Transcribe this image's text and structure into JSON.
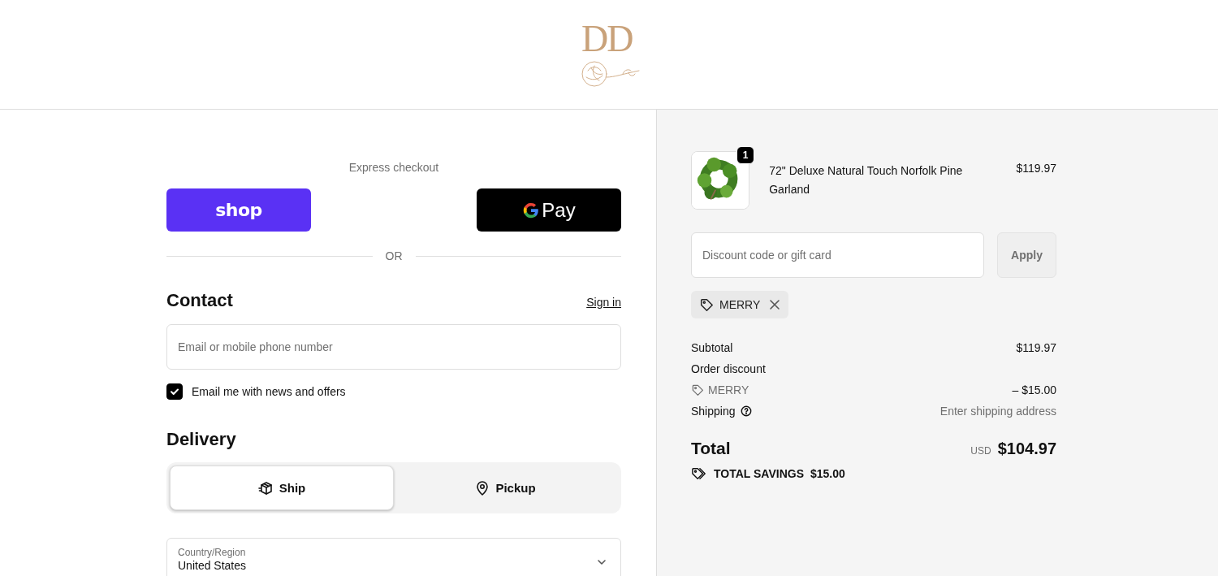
{
  "logo": {
    "letters": "DD"
  },
  "express_checkout": {
    "title": "Express checkout",
    "buttons": [
      {
        "kind": "shop",
        "label": "shop"
      },
      {
        "kind": "gpay",
        "label": "Pay"
      }
    ],
    "divider": "OR"
  },
  "contact": {
    "heading": "Contact",
    "sign_in": "Sign in",
    "email_placeholder": "Email or mobile phone number",
    "newsletter": {
      "label": "Email me with news and offers",
      "checked": true
    }
  },
  "delivery": {
    "heading": "Delivery",
    "methods": [
      {
        "kind": "ship",
        "label": "Ship",
        "selected": true
      },
      {
        "kind": "pickup",
        "label": "Pickup",
        "selected": false
      }
    ],
    "country": {
      "label": "Country/Region",
      "value": "United States"
    }
  },
  "summary": {
    "item": {
      "quantity": "1",
      "name": "72\" Deluxe Natural Touch Norfolk Pine Garland",
      "price": "$119.97"
    },
    "discount": {
      "placeholder": "Discount code or gift card",
      "button": "Apply"
    },
    "applied_codes": [
      {
        "code": "MERRY"
      }
    ],
    "lines": [
      {
        "kind": "subtotal",
        "label": "Subtotal",
        "value": "$119.97"
      },
      {
        "kind": "discount",
        "label": "Order discount",
        "code": "MERRY",
        "value": "– $15.00"
      },
      {
        "kind": "shipping",
        "label": "Shipping",
        "value": "Enter shipping address"
      }
    ],
    "total": {
      "label": "Total",
      "currency": "USD",
      "value": "$104.97"
    },
    "savings": {
      "label": "TOTAL SAVINGS",
      "value": "$15.00"
    }
  }
}
